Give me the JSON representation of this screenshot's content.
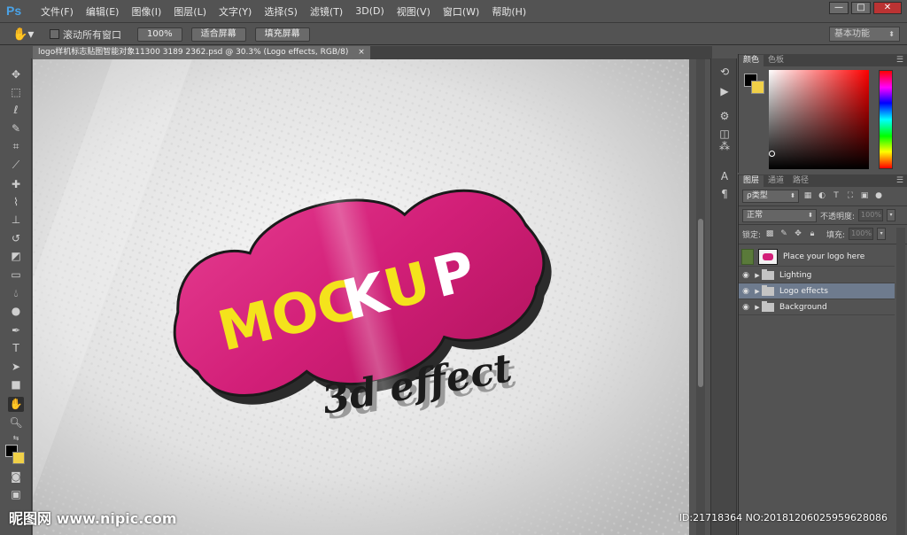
{
  "app": {
    "logo": "Ps"
  },
  "menu": [
    "文件(F)",
    "编辑(E)",
    "图像(I)",
    "图层(L)",
    "文字(Y)",
    "选择(S)",
    "滤镜(T)",
    "3D(D)",
    "视图(V)",
    "窗口(W)",
    "帮助(H)"
  ],
  "window_controls": {
    "minimize": "—",
    "restore": "□",
    "close": "✕"
  },
  "options_bar": {
    "tool_icon": "hand-icon",
    "scroll_all_windows": "滚动所有窗口",
    "scroll_all_checked": false,
    "zoom_100": "100%",
    "fit_screen": "适合屏幕",
    "fill_screen": "填充屏幕",
    "workspace": "基本功能"
  },
  "document": {
    "tab_title": "logo样机标志贴图智能对象11300 3189 2362.psd @ 30.3% (Logo effects, RGB/8)",
    "close": "×",
    "badge_text": "MOCKUP",
    "badge_color": "#d21f78",
    "letter_yellow": "#f4e31c",
    "subtitle": "3d effect"
  },
  "tools": [
    "move-icon",
    "marquee-icon",
    "lasso-icon",
    "quick-select-icon",
    "crop-icon",
    "eyedropper-icon",
    "healing-icon",
    "brush-icon",
    "stamp-icon",
    "history-brush-icon",
    "eraser-icon",
    "gradient-icon",
    "blur-icon",
    "dodge-icon",
    "pen-icon",
    "type-icon",
    "path-select-icon",
    "rectangle-icon",
    "hand-icon",
    "zoom-icon"
  ],
  "colors": {
    "foreground": "#000000",
    "background": "#f0d048"
  },
  "color_panel": {
    "tabs": [
      "颜色",
      "色板"
    ]
  },
  "layers_panel": {
    "tabs": [
      "图层",
      "通道",
      "路径"
    ],
    "filter_kind": "ρ类型",
    "blend_mode": "正常",
    "opacity_label": "不透明度:",
    "opacity_value": "100%",
    "lock_label": "锁定:",
    "fill_label": "填充:",
    "fill_value": "100%",
    "layers": [
      {
        "name": "Place your logo here",
        "type": "smart",
        "selected": false
      },
      {
        "name": "Lighting",
        "type": "group",
        "selected": false
      },
      {
        "name": "Logo effects",
        "type": "group",
        "selected": true
      },
      {
        "name": "Background",
        "type": "group",
        "selected": false
      }
    ]
  },
  "watermark": {
    "left": "昵图网 www.nipic.com",
    "right": "ID:21718364 NO:20181206025959628086"
  }
}
